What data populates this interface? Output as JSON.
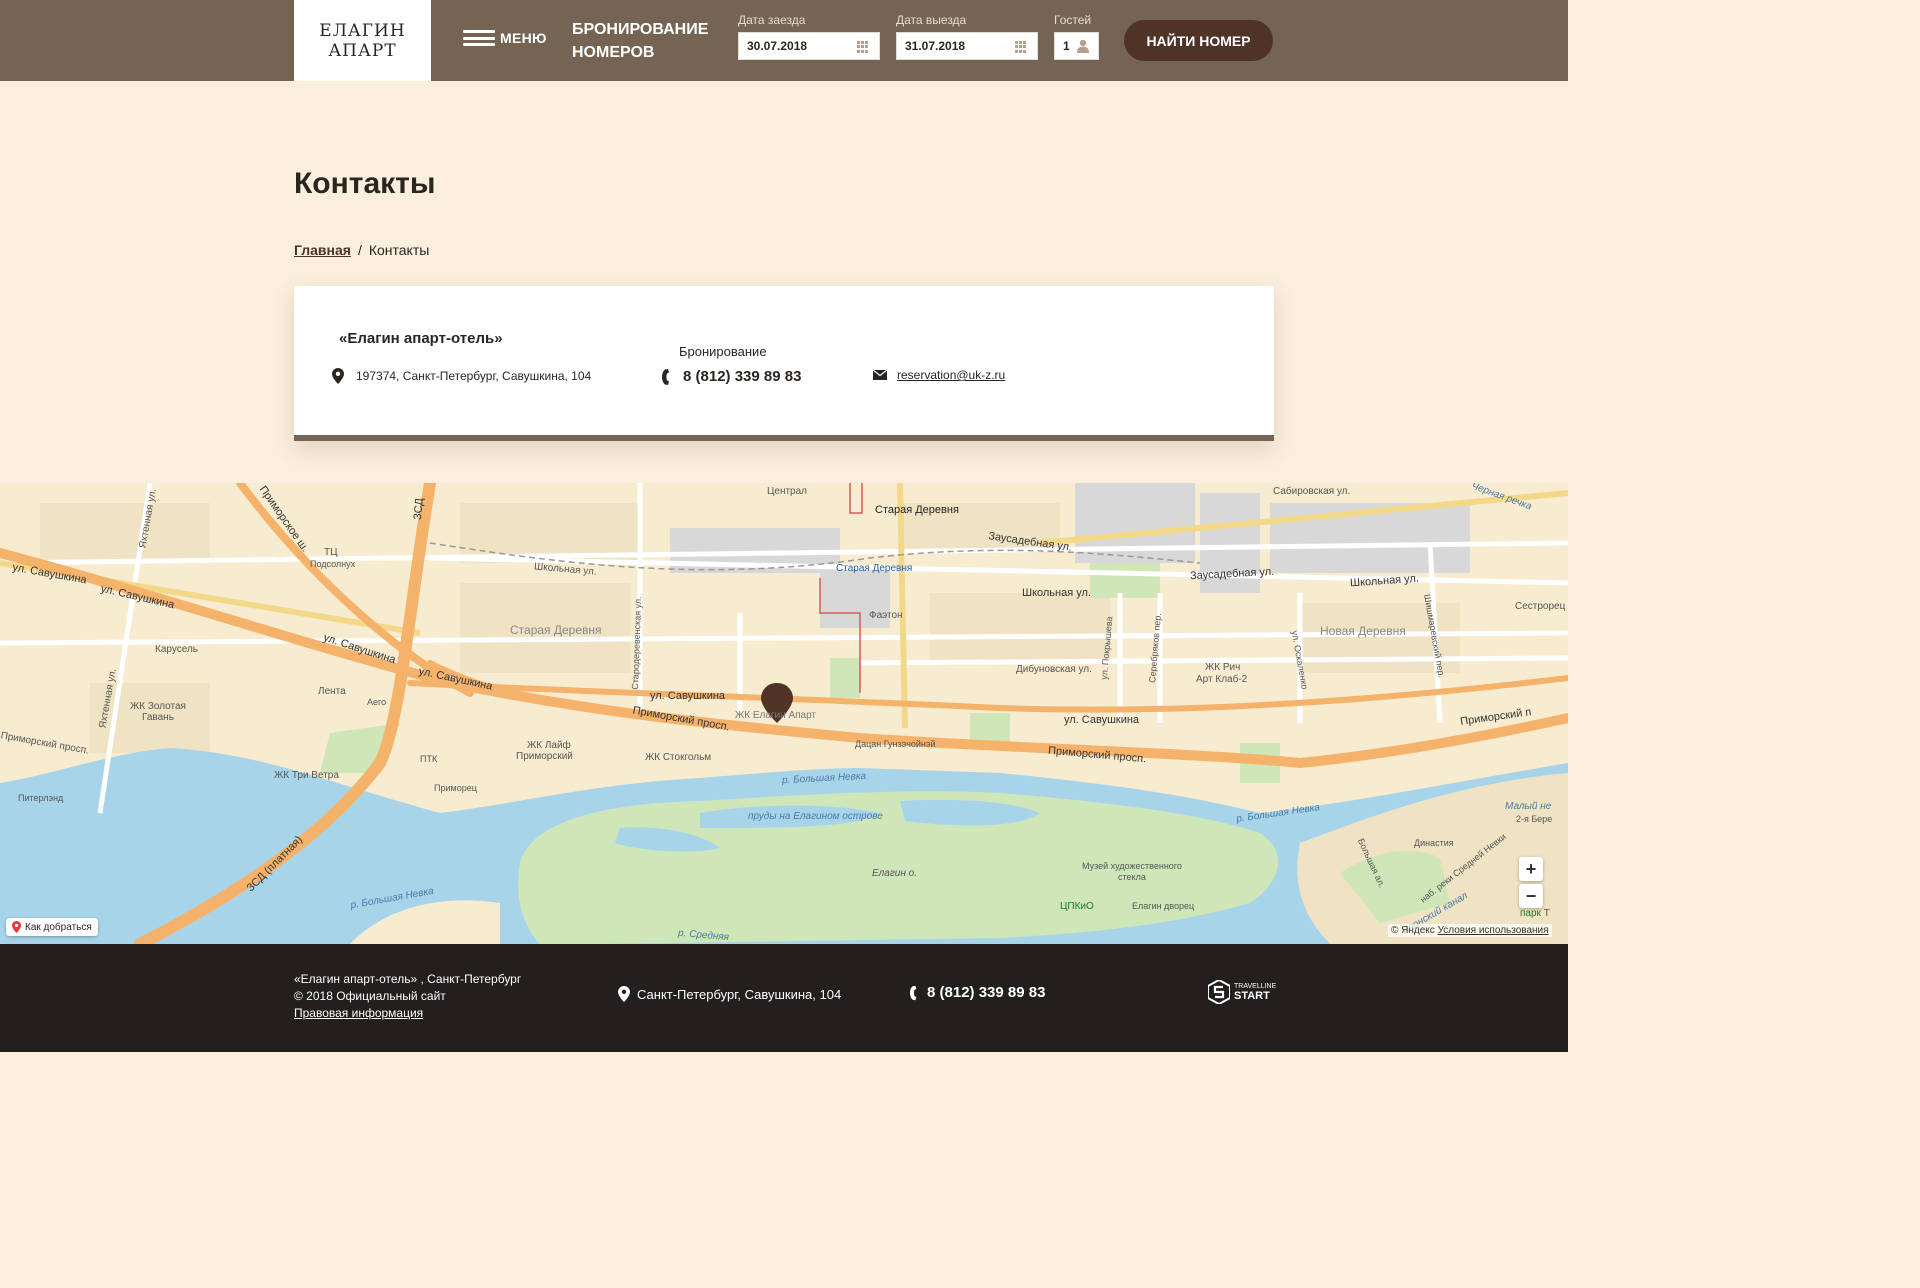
{
  "header": {
    "logo_line1": "ЕЛАГИН",
    "logo_line2": "АПАРТ",
    "menu_label": "МЕНЮ",
    "booking_title": "БРОНИРОВАНИЕ НОМЕРОВ",
    "checkin_label": "Дата заезда",
    "checkin_value": "30.07.2018",
    "checkout_label": "Дата выезда",
    "checkout_value": "31.07.2018",
    "guests_label": "Гостей",
    "guests_value": "1",
    "find_button": "НАЙТИ НОМЕР"
  },
  "page": {
    "title": "Контакты",
    "breadcrumb_home": "Главная",
    "breadcrumb_sep": "/",
    "breadcrumb_current": "Контакты"
  },
  "contacts": {
    "hotel_name": "«Елагин апарт-отель»",
    "address": "197374, Санкт-Петербург, Савушкина, 104",
    "booking_label": "Бронирование",
    "phone": "8 (812) 339 89 83",
    "email": "reservation@uk-z.ru"
  },
  "map": {
    "labels": {
      "tsentral": "Централ",
      "staraya_derevnya_metro": "Старая Деревня",
      "zausadebnaya_1": "Заусадебная ул.",
      "zausadebnaya_2": "Заусадебная ул.",
      "sabirovskaya": "Сабировская ул.",
      "chernaya_rechka": "Черная речка",
      "yakhtennaya": "Яхтенная ул.",
      "primorskoe_sh": "Приморское ш.",
      "zsd": "ЗСД",
      "savushkina_1": "ул. Савушкина",
      "savushkina_2": "ул. Савушкина",
      "savushkina_3": "ул. Савушкина",
      "savushkina_4": "ул. Савушкина",
      "savushkina_5": "ул. Савушкина",
      "savushkina_6": "ул. Савушкина",
      "tts_podsolnukh_1": "ТЦ",
      "tts_podsolnukh_2": "Подсолнух",
      "shkolnaya_1": "Школьная ул.",
      "shkolnaya_2": "Школьная ул.",
      "shkolnaya_3": "Школьная ул.",
      "staraya_derevnya_station": "Старая Деревня",
      "staraya_derevnya_district": "Старая Деревня",
      "starodereven": "Стародеревенская ул.",
      "faeton": "Фаэтон",
      "karusel": "Карусель",
      "novaya_derevnya": "Новая Деревня",
      "sestroretskaya": "Сестрорец",
      "dibunovskaya": "Дибуновская ул.",
      "pokrysheva": "ул. Покрышева",
      "serebryakov": "Серебряков пер.",
      "oskalenko": "ул. Оскаленко",
      "shishmarevsky": "Шишмаревский пер.",
      "zhk_rich_1": "ЖК Рич",
      "zhk_rich_2": "Арт Клаб-2",
      "lenta": "Лента",
      "aego": "Аего",
      "zhk_zolotaya_1": "ЖК Золотая",
      "zhk_zolotaya_2": "Гавань",
      "zhk_elagin": "ЖК Елагин Апарт",
      "primorsky_1": "Приморский просп.",
      "primorsky_2": "Приморский просп.",
      "primorsky_3": "Приморский п",
      "primorsky_4": "Приморский просп.",
      "yakhtennaya_2": "Яхтенная ул.",
      "zhk_layf_1": "ЖК Лайф",
      "zhk_layf_2": "Приморский",
      "zhk_stokgolm": "ЖК Стокгольм",
      "datsan": "Дацан Гунзэчойнэй",
      "ptk": "ПТК",
      "zhk_tri_vetra": "ЖК Три Ветра",
      "primorets": "Приморец",
      "piterlend": "Питерлэнд",
      "bolshaya_nevka_1": "р. Большая Невка",
      "bolshaya_nevka_2": "р. Большая Невка",
      "bolshaya_nevka_3": "р. Большая Невка",
      "prudy": "пруды на Елагином острове",
      "malaya_nevka": "Малый не",
      "dinastiya": "Династия",
      "vtoraya_bere": "2-я Бере",
      "muzey_1": "Музей художественного",
      "muzey_2": "стекла",
      "elagin_o": "Елагин о.",
      "tspkio": "ЦПКиО",
      "elagin_dvorets": "Елагин дворец",
      "zsd_platnaya": "ЗСД (платная)",
      "srednyaya_nevka_1": "р. Средняя",
      "srednyaya_nevka_2": "наб. реки Средней Невки",
      "bolshaya_al": "Большая ал.",
      "yaponsky_kanal": "Японский канал",
      "park_t": "парк Т"
    },
    "route_button": "Как добраться",
    "zoom_in": "+",
    "zoom_out": "−",
    "yandex_copy": "© Яндекс",
    "terms_link": "Условия использования"
  },
  "footer": {
    "line1": "«Елагин апарт-отель» , Санкт-Петербург",
    "line2": "© 2018 Официальный сайт",
    "legal_link": "Правовая информация",
    "address": "Санкт-Петербург, Савушкина, 104",
    "phone": "8 (812) 339 89 83",
    "tl_small": "TRAVELLINE",
    "tl_big": "START"
  },
  "colors": {
    "header_bg": "#756454",
    "page_bg": "#faeedc",
    "button_bg": "#4f3326",
    "footer_bg": "#221f1e",
    "map_road": "#f5b26b",
    "map_water": "#a8d4ea",
    "map_park": "#cfe6b9"
  }
}
